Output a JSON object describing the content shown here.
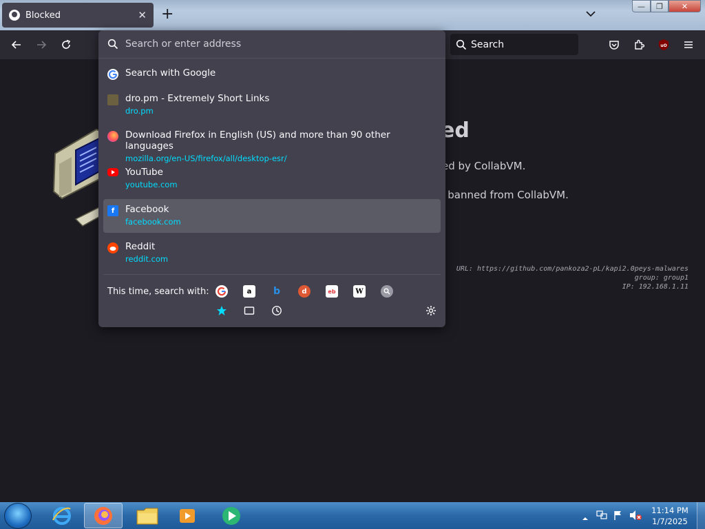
{
  "window": {
    "tab_title": "Blocked",
    "tab_close": "✕",
    "new_tab": "+",
    "min": "—",
    "max": "❐",
    "close": "✕"
  },
  "toolbar": {
    "search_label": "Search"
  },
  "page": {
    "heading_fragment": "ed",
    "line1_fragment": "ed by CollabVM.",
    "line2_fragment": "g banned from CollabVM.",
    "meta_url": "URL: https://github.com/pankoza2-pL/kapi2.0peys-malwares",
    "meta_group": "group: group1",
    "meta_ip": "IP: 192.168.1.11"
  },
  "urlbar": {
    "placeholder": "Search or enter address"
  },
  "results": [
    {
      "title": "Search with Google",
      "url": "",
      "icon": "google-icon"
    },
    {
      "title": "dro.pm - Extremely Short Links",
      "url": "dro.pm",
      "icon": "dropm-icon"
    },
    {
      "title": "Download Firefox in English (US) and more than 90 other languages",
      "url": "mozilla.org/en-US/firefox/all/desktop-esr/",
      "icon": "firefox-icon"
    },
    {
      "title": "YouTube",
      "url": "youtube.com",
      "icon": "youtube-icon"
    },
    {
      "title": "Facebook",
      "url": "facebook.com",
      "icon": "facebook-icon",
      "selected": true
    },
    {
      "title": "Reddit",
      "url": "reddit.com",
      "icon": "reddit-icon"
    }
  ],
  "oneoff": {
    "label": "This time, search with:",
    "engines": [
      "google-icon",
      "amazon-icon",
      "bing-icon",
      "duckduckgo-icon",
      "ebay-icon",
      "wikipedia-icon",
      "search-engine-icon"
    ],
    "modes": [
      "bookmarks-icon",
      "tabs-icon",
      "history-icon"
    ]
  },
  "taskbar": {
    "time": "11:14 PM",
    "date": "1/7/2025"
  },
  "colors": {
    "accent": "#00ddff",
    "panel": "#42414d",
    "selected": "#5b5b66",
    "page_bg": "#1c1b22"
  }
}
